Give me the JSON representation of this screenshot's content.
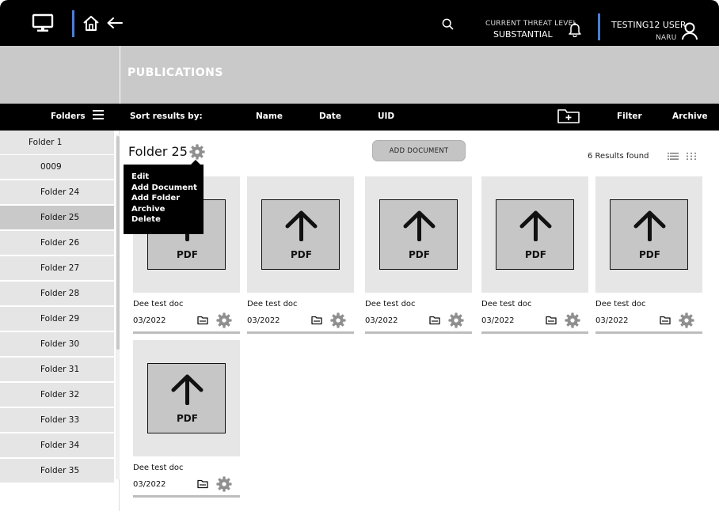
{
  "header": {
    "threat_label": "CURRENT THREAT LEVEL",
    "threat_value": "SUBSTANTIAL",
    "user_name": "TESTING12 USER",
    "user_org": "NARU"
  },
  "page": {
    "title": "PUBLICATIONS"
  },
  "toolbar": {
    "folders_label": "Folders",
    "sort_label": "Sort results by:",
    "sort_options": [
      "Name",
      "Date",
      "UID"
    ],
    "filter_label": "Filter",
    "archive_label": "Archive"
  },
  "sidebar": {
    "items": [
      {
        "label": "Folder 1"
      },
      {
        "label": "0009"
      },
      {
        "label": "Folder 24"
      },
      {
        "label": "Folder 25"
      },
      {
        "label": "Folder 26"
      },
      {
        "label": "Folder 27"
      },
      {
        "label": "Folder 28"
      },
      {
        "label": "Folder 29"
      },
      {
        "label": "Folder 30"
      },
      {
        "label": "Folder 31"
      },
      {
        "label": "Folder 32"
      },
      {
        "label": "Folder 33"
      },
      {
        "label": "Folder 34"
      },
      {
        "label": "Folder 35"
      }
    ],
    "active": "Folder 25"
  },
  "main": {
    "folder_title": "Folder 25",
    "add_document_label": "ADD DOCUMENT",
    "results_count": "6 Results found",
    "context_menu": [
      "Edit",
      "Add Document",
      "Add Folder",
      "Archive",
      "Delete"
    ],
    "cards": [
      {
        "type_label": "PDF",
        "title": "Dee test doc",
        "date": "03/2022"
      },
      {
        "type_label": "PDF",
        "title": "Dee test doc",
        "date": "03/2022"
      },
      {
        "type_label": "PDF",
        "title": "Dee test doc",
        "date": "03/2022"
      },
      {
        "type_label": "PDF",
        "title": "Dee test doc",
        "date": "03/2022"
      },
      {
        "type_label": "PDF",
        "title": "Dee test doc",
        "date": "03/2022"
      },
      {
        "type_label": "PDF",
        "title": "Dee test doc",
        "date": "03/2022"
      }
    ]
  },
  "icons": {
    "monitor": "monitor-icon",
    "home": "home-icon",
    "back": "arrow-left-icon",
    "search": "search-icon",
    "bell": "bell-icon",
    "user": "user-icon",
    "menu": "hamburger-icon",
    "new_folder": "folder-plus-icon",
    "settings": "gear-icon",
    "folder": "folder-icon",
    "grid_view": "grid-view-icon",
    "list_view": "list-view-icon",
    "upload": "upload-arrow-icon"
  },
  "colors": {
    "header_bg": "#000000",
    "banner_bg": "#c9c9c9",
    "accent_bar": "#4a7fd4",
    "card_bg": "#e6e6e6",
    "active_item_bg": "#c9c9c9"
  }
}
